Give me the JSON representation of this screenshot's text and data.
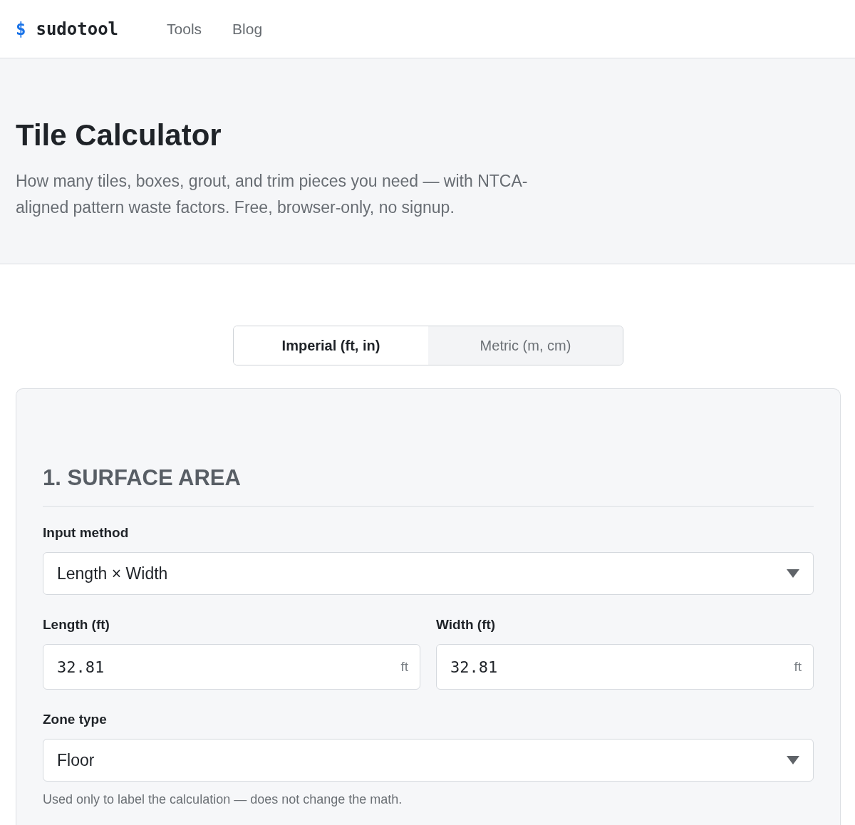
{
  "header": {
    "logo": {
      "symbol": "$",
      "name": "sudotool"
    },
    "nav": [
      {
        "label": "Tools"
      },
      {
        "label": "Blog"
      }
    ]
  },
  "hero": {
    "title": "Tile Calculator",
    "description": "How many tiles, boxes, grout, and trim pieces you need — with NTCA-aligned pattern waste factors. Free, browser-only, no signup."
  },
  "unit_tabs": [
    {
      "label": "Imperial (ft, in)",
      "selected": true
    },
    {
      "label": "Metric (m, cm)",
      "selected": false
    }
  ],
  "section": {
    "heading": "1. SURFACE AREA",
    "fields": [
      {
        "kind": "select",
        "label": "Input method",
        "value": "Length × Width"
      },
      {
        "kind": "number_pair",
        "items": [
          {
            "label": "Length (ft)",
            "value": "32.81",
            "unit": "ft"
          },
          {
            "label": "Width (ft)",
            "value": "32.81",
            "unit": "ft"
          }
        ]
      },
      {
        "kind": "select",
        "label": "Zone type",
        "value": "Floor",
        "hint": "Used only to label the calculation — does not change the math."
      }
    ]
  }
}
